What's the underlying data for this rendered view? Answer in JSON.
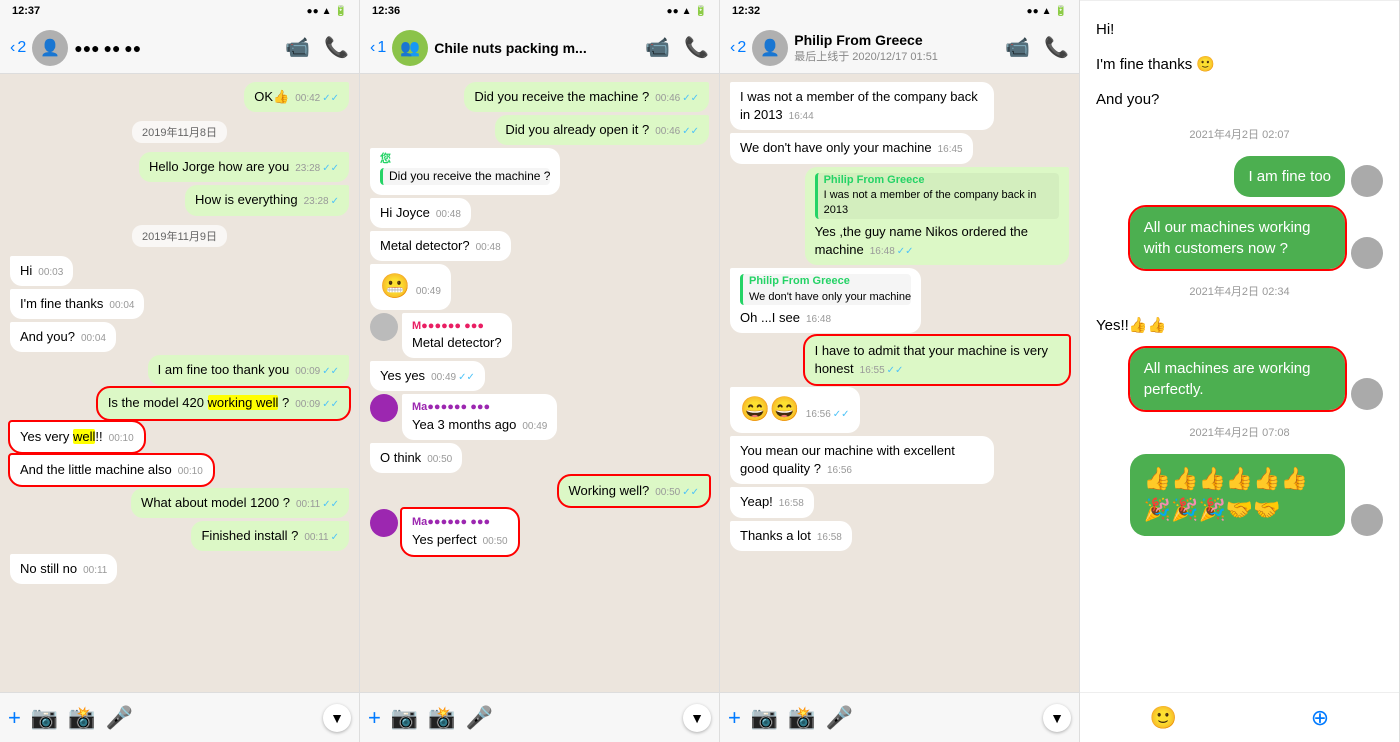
{
  "panel1": {
    "status_time": "12:37",
    "header": {
      "back_count": "2",
      "name": "●●● ●● ●●",
      "avatar_emoji": "👤"
    },
    "messages": [
      {
        "id": "p1m1",
        "type": "outgoing",
        "text": "OK👍",
        "time": "00:42",
        "check": "✓✓"
      },
      {
        "id": "p1date1",
        "type": "date",
        "text": "2019年11月8日"
      },
      {
        "id": "p1m2",
        "type": "outgoing",
        "text": "Hello Jorge how are you",
        "time": "23:28",
        "check": "✓✓"
      },
      {
        "id": "p1m3",
        "type": "outgoing",
        "text": "How is everything",
        "time": "23:28",
        "check": "✓"
      },
      {
        "id": "p1date2",
        "type": "date",
        "text": "2019年11月9日"
      },
      {
        "id": "p1m4",
        "type": "incoming",
        "text": "Hi",
        "time": "00:03"
      },
      {
        "id": "p1m5",
        "type": "incoming",
        "text": "I'm fine thanks",
        "time": "00:04"
      },
      {
        "id": "p1m6",
        "type": "incoming",
        "text": "And you?",
        "time": "00:04"
      },
      {
        "id": "p1m7",
        "type": "outgoing",
        "text": "I am fine too thank you",
        "time": "00:09",
        "check": "✓✓"
      },
      {
        "id": "p1m8",
        "type": "outgoing",
        "text": "Is the model 420 working well ?",
        "time": "00:09",
        "check": "✓✓",
        "highlighted": true,
        "highlight_words": [
          "working well"
        ]
      },
      {
        "id": "p1m9",
        "type": "incoming",
        "text": "Yes very well!!",
        "time": "00:10",
        "highlighted": true,
        "highlight_words": [
          "well"
        ]
      },
      {
        "id": "p1m10",
        "type": "incoming",
        "text": "And the little machine also",
        "time": "00:10",
        "highlighted": true
      },
      {
        "id": "p1m11",
        "type": "outgoing",
        "text": "What about model 1200 ?",
        "time": "00:11",
        "check": "✓✓"
      },
      {
        "id": "p1m12",
        "type": "outgoing",
        "text": "Finished install ?",
        "time": "00:11",
        "check": "✓"
      },
      {
        "id": "p1m13",
        "type": "incoming",
        "text": "No still no",
        "time": "00:11"
      }
    ],
    "bottom_icons": [
      "+",
      "📷",
      "📸",
      "🎤"
    ]
  },
  "panel2": {
    "status_time": "12:36",
    "header": {
      "back_count": "1",
      "name": "Chile nuts packing m...",
      "avatar_emoji": "👥"
    },
    "messages": [
      {
        "id": "p2m1",
        "type": "outgoing",
        "text": "Did you receive the machine ?",
        "time": "00:46",
        "check": "✓✓"
      },
      {
        "id": "p2m2",
        "type": "outgoing",
        "text": "Did you already open it ?",
        "time": "00:46",
        "check": "✓✓"
      },
      {
        "id": "p2m3",
        "type": "incoming",
        "text": "您",
        "time": "",
        "has_avatar": true
      },
      {
        "id": "p2m3b",
        "type": "incoming",
        "text": "Did you receive the machine ?",
        "time": "",
        "sub": true
      },
      {
        "id": "p2m4",
        "type": "incoming",
        "text": "Hi Joyce",
        "time": "00:48"
      },
      {
        "id": "p2m5",
        "type": "incoming",
        "text": "Metal detector?",
        "time": "00:48"
      },
      {
        "id": "p2emoji",
        "type": "incoming",
        "text": "😬",
        "time": "00:49",
        "emoji_only": true
      },
      {
        "id": "p2m6",
        "type": "incoming_named",
        "name": "M●●●●●● ●●●",
        "text": "Metal detector?",
        "time": "",
        "has_avatar2": true
      },
      {
        "id": "p2m7",
        "type": "incoming",
        "text": "Yes yes",
        "time": "00:49",
        "check": "✓✓"
      },
      {
        "id": "p2m8",
        "type": "incoming_named2",
        "name": "Ma●●●●●● ●●●",
        "text": "Yea 3 months ago",
        "time": "00:49"
      },
      {
        "id": "p2m9",
        "type": "incoming",
        "text": "O think",
        "time": "00:50"
      },
      {
        "id": "p2m10",
        "type": "outgoing",
        "text": "Working well?",
        "time": "00:50",
        "check": "✓✓",
        "highlighted": true
      },
      {
        "id": "p2m11",
        "type": "incoming_named3",
        "name": "Ma●●●●●● ●●●",
        "text": "Yes perfect",
        "time": "00:50",
        "highlighted": true
      }
    ],
    "bottom_icons": [
      "+",
      "📷",
      "📸",
      "🎤"
    ]
  },
  "panel3": {
    "status_time": "12:32",
    "header": {
      "back_count": "2",
      "name": "Philip From Greece",
      "sub": "最后上线于 2020/12/17 01:51",
      "avatar_emoji": "👤"
    },
    "messages": [
      {
        "id": "p3m1",
        "type": "incoming",
        "text": "I was not a member of the company back in 2013",
        "time": "16:44"
      },
      {
        "id": "p3m2",
        "type": "incoming",
        "text": "We don't have only your machine",
        "time": "16:45"
      },
      {
        "id": "p3quoted1",
        "type": "quoted_block",
        "quoted_name": "Philip From Greece",
        "quoted_text": "I was not a member of the company back in 2013",
        "text": "Yes ,the guy name Nikos ordered the machine",
        "time": "16:48",
        "check": "✓✓"
      },
      {
        "id": "p3quoted2",
        "type": "quoted_block",
        "quoted_name": "Philip From Greece",
        "quoted_text": "We don't have only your machine",
        "text": "Oh ...I see",
        "time": "16:48"
      },
      {
        "id": "p3m3",
        "type": "outgoing",
        "text": "I have to admit that your machine is very honest",
        "time": "16:55",
        "check": "✓✓",
        "highlighted": true
      },
      {
        "id": "p3emoji2",
        "type": "incoming",
        "text": "😄😄",
        "time": "16:56",
        "check": "✓✓",
        "emoji_only": true
      },
      {
        "id": "p3m4",
        "type": "incoming",
        "text": "You mean our machine with excellent good quality ?",
        "time": "16:56"
      },
      {
        "id": "p3m5",
        "type": "incoming",
        "text": "Yeap!",
        "time": "16:58"
      },
      {
        "id": "p3m6",
        "type": "incoming",
        "text": "Thanks a lot",
        "time": "16:58"
      }
    ],
    "bottom_icons": [
      "+",
      "📷",
      "📸",
      "🎤"
    ]
  },
  "panel4": {
    "messages": [
      {
        "id": "p4m1",
        "type": "incoming",
        "text": "Hi!"
      },
      {
        "id": "p4m2",
        "type": "incoming",
        "text": "I'm fine thanks 🙂"
      },
      {
        "id": "p4m3",
        "type": "incoming",
        "text": "And you?"
      },
      {
        "id": "p4date1",
        "type": "date",
        "text": "2021年4月2日 02:07"
      },
      {
        "id": "p4m4",
        "type": "outgoing",
        "text": "I am fine too",
        "has_avatar": true
      },
      {
        "id": "p4m5",
        "type": "outgoing",
        "text": "All our machines working with customers now ?",
        "highlighted": true,
        "has_avatar": true
      },
      {
        "id": "p4date2",
        "type": "date",
        "text": "2021年4月2日 02:34"
      },
      {
        "id": "p4m6",
        "type": "incoming",
        "text": "Yes!!👍👍"
      },
      {
        "id": "p4m7",
        "type": "outgoing",
        "text": "All machines are working perfectly.",
        "highlighted": true,
        "has_avatar": true
      },
      {
        "id": "p4date3",
        "type": "date",
        "text": "2021年4月2日 07:08"
      },
      {
        "id": "p4m8",
        "type": "outgoing",
        "text": "👍👍👍👍👍👍🎉🎉🎉🤝🤝",
        "emoji_only": true,
        "has_avatar": true
      }
    ]
  }
}
